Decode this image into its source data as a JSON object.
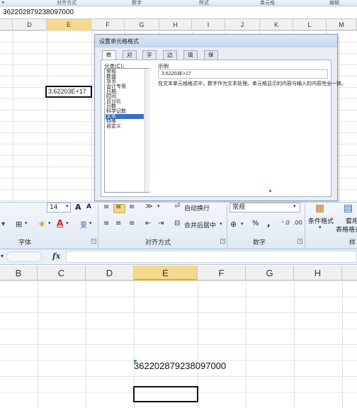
{
  "top": {
    "ribbon_groups": [
      "对齐方式",
      "数字",
      "样式",
      "单元格",
      "编辑"
    ],
    "formula_value": "362202879238097000",
    "columns": [
      "D",
      "E",
      "F",
      "G",
      "H",
      "I",
      "J",
      "K",
      "L",
      "M"
    ],
    "selected_column": "E",
    "cell_display": "3.62203E+17"
  },
  "dialog": {
    "title": "设置单元格格式",
    "tabs": [
      "数字",
      "对齐",
      "字体",
      "边框",
      "填充",
      "保护"
    ],
    "active_tab": "数字",
    "category_label": "分类(C):",
    "categories": [
      "常规",
      "数值",
      "货币",
      "会计专用",
      "日期",
      "时间",
      "百分比",
      "分数",
      "科学记数",
      "文本",
      "特殊",
      "自定义"
    ],
    "selected_category": "文本",
    "sample_label": "示例",
    "sample_value": "3.62203E+17",
    "description": "在文本单元格格式中，数字作为文本处理。单元格显示的内容与输入的内容完全一致。"
  },
  "ribbon": {
    "font_size": "14",
    "font_grow": "A",
    "font_shrink": "A",
    "wrap_text": "自动换行",
    "merge_center": "合并后居中",
    "number_format": "常规",
    "percent": "%",
    "comma": ",",
    "conditional_format": "条件格式",
    "table_format_line1": "套用",
    "table_format_line2": "表格格式",
    "group_font": "字体",
    "group_alignment": "对齐方式",
    "group_number": "数字",
    "group_styles_partial": "样",
    "phonetic": "变",
    "font_color_letter": "A"
  },
  "formula_bar": {
    "fx": "fx"
  },
  "bottom": {
    "columns": [
      "B",
      "C",
      "D",
      "E",
      "F",
      "G",
      "H"
    ],
    "selected_column": "E",
    "cell_value": "362202879238097000"
  },
  "colors": {
    "selected_header": "#f7d98e",
    "ribbon_active": "#f6d68a",
    "list_selection": "#3a6fc8",
    "error_triangle": "#2e9b3a"
  }
}
